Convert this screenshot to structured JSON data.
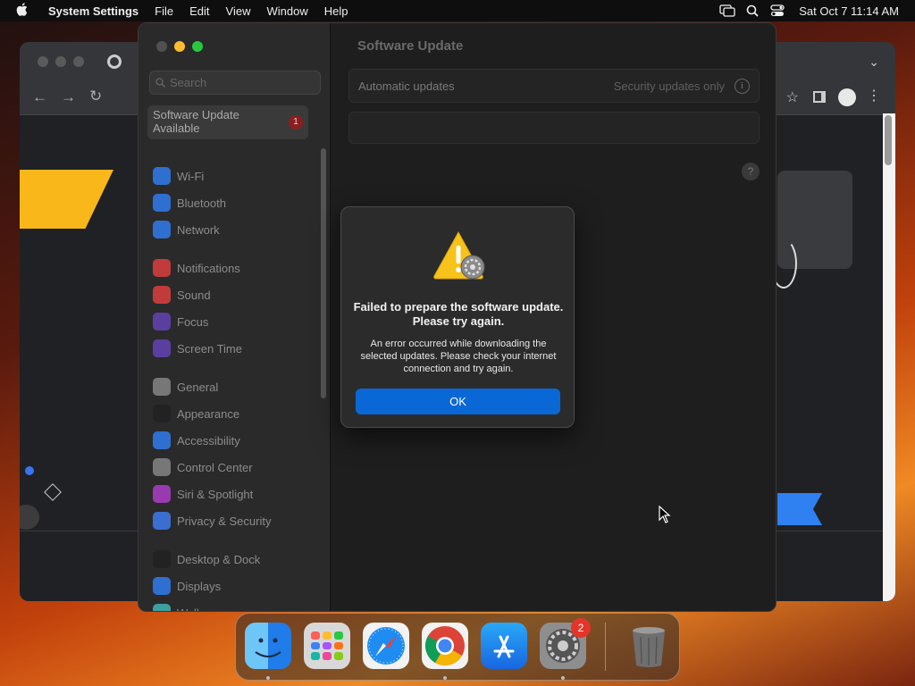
{
  "menubar": {
    "app": "System Settings",
    "items": [
      "File",
      "Edit",
      "View",
      "Window",
      "Help"
    ],
    "clock": "Sat Oct 7  11:14 AM"
  },
  "settings": {
    "search_placeholder": "Search",
    "update_item": {
      "line1": "Software Update",
      "line2": "Available",
      "badge": "1"
    },
    "sidebar": [
      {
        "label": "Wi-Fi",
        "color": "#2f6fd0",
        "icon": "wifi-icon"
      },
      {
        "label": "Bluetooth",
        "color": "#2f6fd0",
        "icon": "bluetooth-icon"
      },
      {
        "label": "Network",
        "color": "#2f6fd0",
        "icon": "globe-icon"
      },
      {
        "label": "Notifications",
        "color": "#c23b3b",
        "icon": "bell-icon"
      },
      {
        "label": "Sound",
        "color": "#c23b3b",
        "icon": "speaker-icon"
      },
      {
        "label": "Focus",
        "color": "#5a3fa0",
        "icon": "moon-icon"
      },
      {
        "label": "Screen Time",
        "color": "#5a3fa0",
        "icon": "hourglass-icon"
      },
      {
        "label": "General",
        "color": "#777777",
        "icon": "gear-icon"
      },
      {
        "label": "Appearance",
        "color": "#222222",
        "icon": "appearance-icon"
      },
      {
        "label": "Accessibility",
        "color": "#2f6fd0",
        "icon": "accessibility-icon"
      },
      {
        "label": "Control Center",
        "color": "#777777",
        "icon": "control-center-icon"
      },
      {
        "label": "Siri & Spotlight",
        "color": "#9a3ab0",
        "icon": "siri-icon"
      },
      {
        "label": "Privacy & Security",
        "color": "#3a6fd0",
        "icon": "hand-icon"
      },
      {
        "label": "Desktop & Dock",
        "color": "#222222",
        "icon": "dock-icon"
      },
      {
        "label": "Displays",
        "color": "#2f6fd0",
        "icon": "sun-icon"
      },
      {
        "label": "Wallpaper",
        "color": "#3aa0a0",
        "icon": "wallpaper-icon"
      }
    ],
    "content": {
      "title": "Software Update",
      "auto_label": "Automatic updates",
      "auto_value": "Security updates only",
      "help": "?"
    }
  },
  "dialog": {
    "heading": "Failed to prepare the software update. Please try again.",
    "message": "An error occurred while downloading the selected updates. Please check your internet connection and try again.",
    "ok": "OK"
  },
  "dock": {
    "settings_badge": "2",
    "apps": [
      "Finder",
      "Launchpad",
      "Safari",
      "Google Chrome",
      "App Store",
      "System Settings",
      "Trash"
    ]
  }
}
